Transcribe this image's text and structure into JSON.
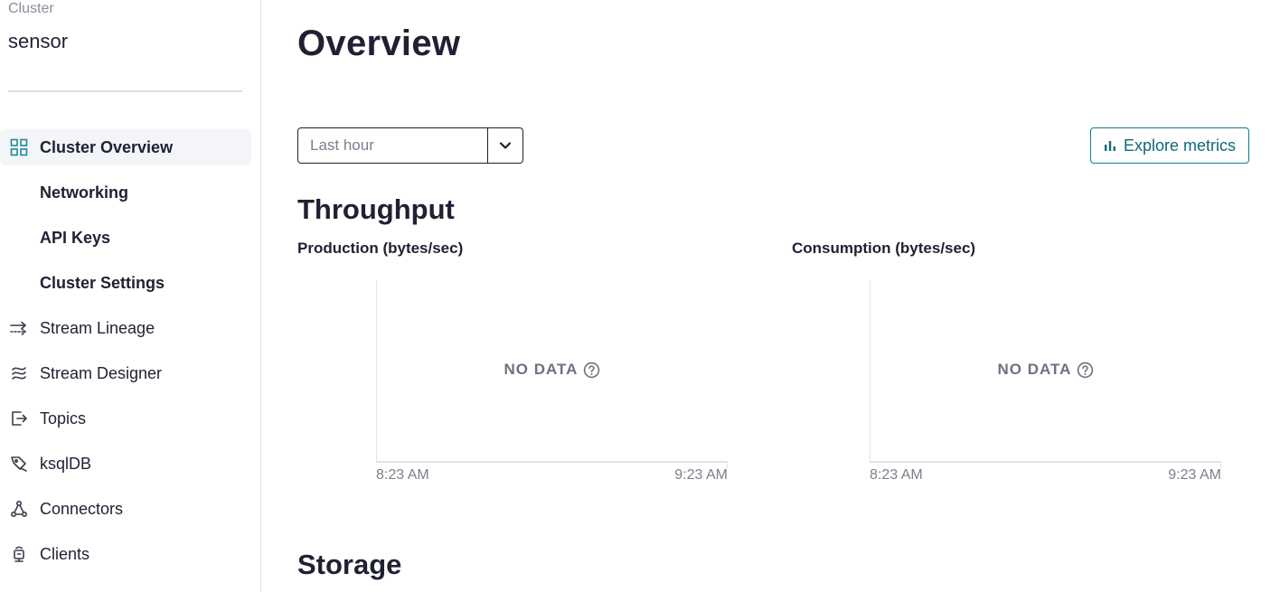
{
  "sidebar": {
    "cluster_caption": "Cluster",
    "cluster_name": "sensor",
    "items": [
      {
        "label": "Cluster Overview",
        "icon": "grid-icon",
        "active": true
      },
      {
        "label": "Networking"
      },
      {
        "label": "API Keys"
      },
      {
        "label": "Cluster Settings"
      },
      {
        "label": "Stream Lineage",
        "icon": "lineage-arrows-icon"
      },
      {
        "label": "Stream Designer",
        "icon": "stream-designer-icon"
      },
      {
        "label": "Topics",
        "icon": "topics-icon"
      },
      {
        "label": "ksqlDB",
        "icon": "ksqldb-icon"
      },
      {
        "label": "Connectors",
        "icon": "connectors-icon"
      },
      {
        "label": "Clients",
        "icon": "clients-icon"
      }
    ]
  },
  "main": {
    "title": "Overview",
    "time_range": {
      "selected": "Last hour"
    },
    "explore_metrics_label": "Explore metrics",
    "throughput": {
      "title": "Throughput",
      "charts": [
        {
          "label": "Production (bytes/sec)",
          "empty_text": "NO DATA",
          "x_start": "8:23 AM",
          "x_end": "9:23 AM"
        },
        {
          "label": "Consumption (bytes/sec)",
          "empty_text": "NO DATA",
          "x_start": "8:23 AM",
          "x_end": "9:23 AM"
        }
      ]
    },
    "storage": {
      "title": "Storage"
    }
  },
  "colors": {
    "accent": "#0f7b8c",
    "text": "#1f2133",
    "muted": "#7c7f8c",
    "active_bg": "#f4f5f8"
  }
}
